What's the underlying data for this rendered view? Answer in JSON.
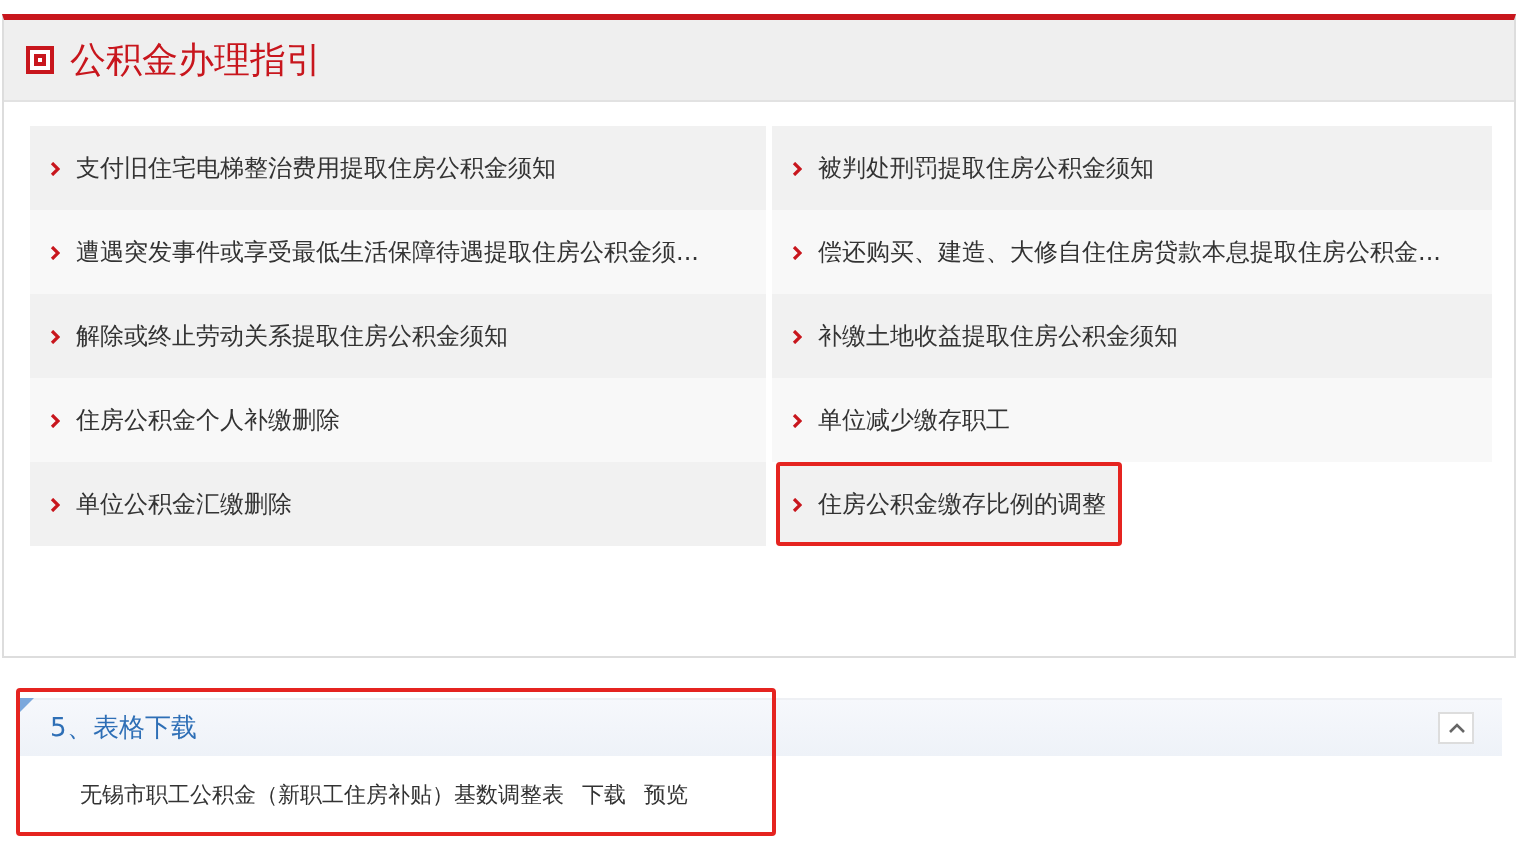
{
  "guide": {
    "title": "公积金办理指引",
    "items": [
      {
        "label": "支付旧住宅电梯整治费用提取住房公积金须知",
        "highlighted": false
      },
      {
        "label": "被判处刑罚提取住房公积金须知",
        "highlighted": false
      },
      {
        "label": "遭遇突发事件或享受最低生活保障待遇提取住房公积金须...",
        "highlighted": false
      },
      {
        "label": "偿还购买、建造、大修自住住房贷款本息提取住房公积金...",
        "highlighted": false
      },
      {
        "label": "解除或终止劳动关系提取住房公积金须知",
        "highlighted": false
      },
      {
        "label": "补缴土地收益提取住房公积金须知",
        "highlighted": false
      },
      {
        "label": "住房公积金个人补缴删除",
        "highlighted": false
      },
      {
        "label": "单位减少缴存职工",
        "highlighted": false
      },
      {
        "label": "单位公积金汇缴删除",
        "highlighted": false
      },
      {
        "label": "住房公积金缴存比例的调整",
        "highlighted": true
      }
    ]
  },
  "downloads": {
    "title": "5、表格下载",
    "highlighted": true,
    "expanded": true,
    "files": [
      {
        "name": "无锡市职工公积金（新职工住房补贴）基数调整表",
        "download": "下载",
        "preview": "预览"
      }
    ]
  }
}
